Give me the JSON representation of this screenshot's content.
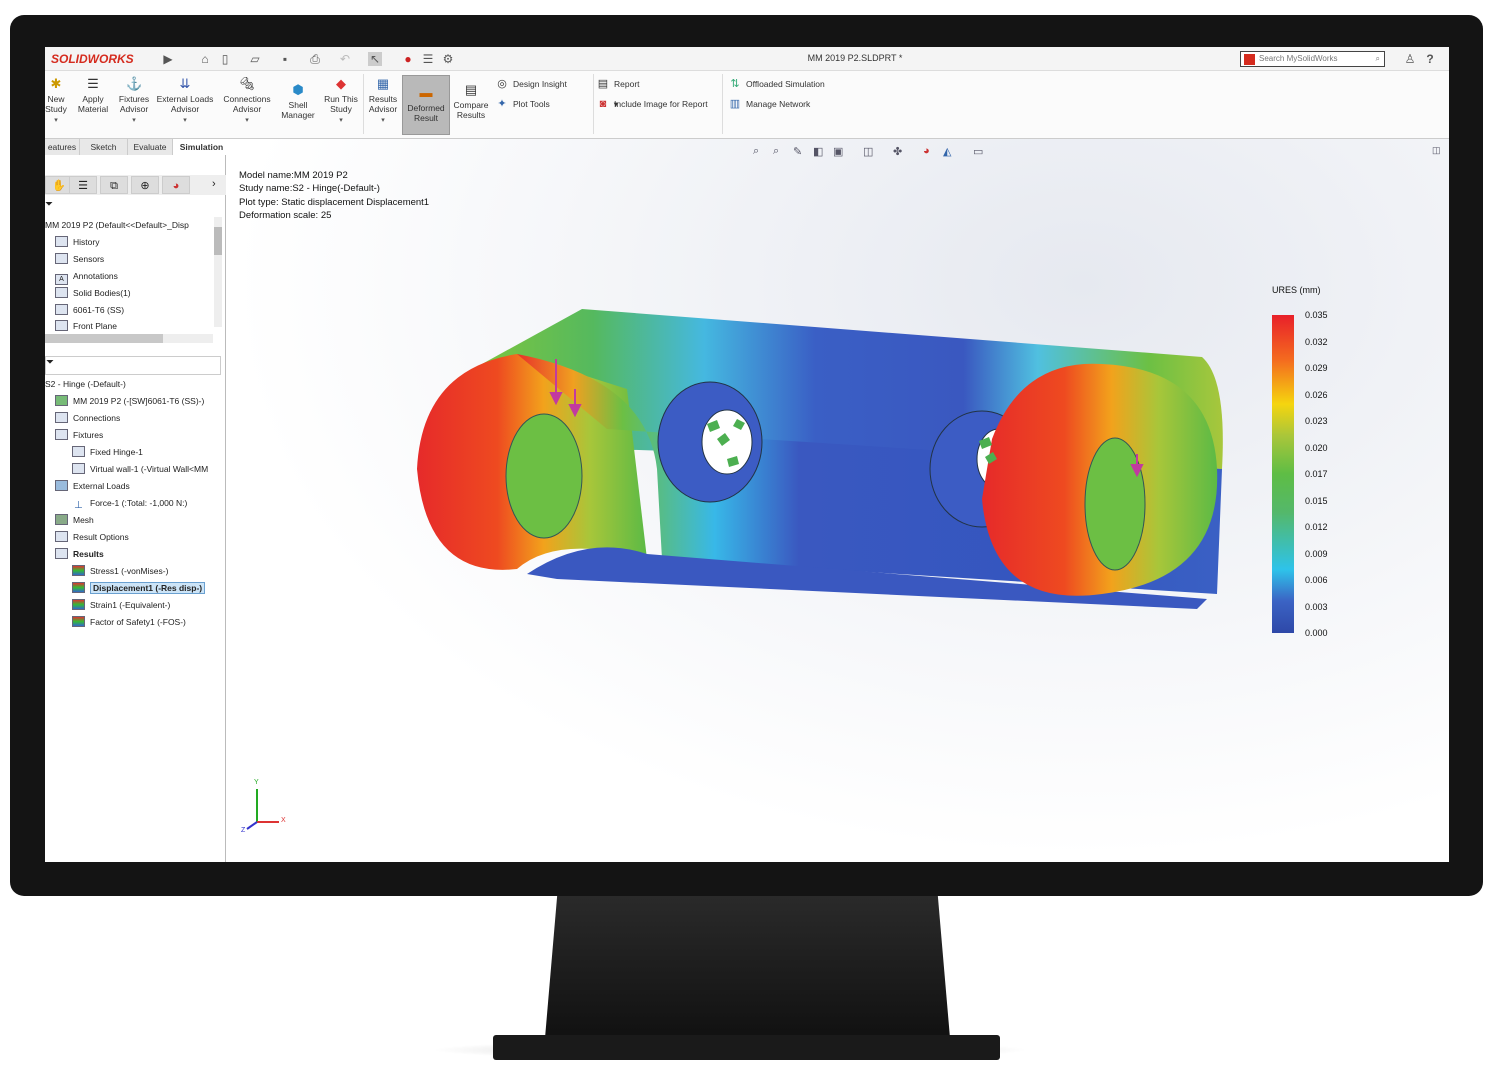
{
  "app": {
    "brand": "SOLIDWORKS",
    "document_title": "MM 2019 P2.SLDPRT *",
    "search_placeholder": "Search MySolidWorks",
    "help": "?"
  },
  "ribbon": {
    "buttons": [
      {
        "label": "New Study",
        "icon": "new-study-icon"
      },
      {
        "label": "Apply Material",
        "icon": "apply-material-icon"
      },
      {
        "label": "Fixtures Advisor",
        "icon": "fixtures-icon"
      },
      {
        "label": "External Loads Advisor",
        "icon": "external-loads-icon"
      },
      {
        "label": "Connections Advisor",
        "icon": "connections-icon"
      },
      {
        "label": "Shell Manager",
        "icon": "shell-icon"
      },
      {
        "label": "Run This Study",
        "icon": "run-study-icon"
      },
      {
        "label": "Results Advisor",
        "icon": "results-advisor-icon"
      },
      {
        "label": "Deformed Result",
        "icon": "deformed-result-icon",
        "active": true
      },
      {
        "label": "Compare Results",
        "icon": "compare-results-icon"
      }
    ],
    "small": [
      "Design Insight",
      "Plot Tools",
      "Report",
      "Include Image for Report",
      "Offloaded Simulation",
      "Manage Network"
    ]
  },
  "tabs": [
    "eatures",
    "Sketch",
    "Evaluate",
    "Simulation"
  ],
  "active_tab": "Simulation",
  "feature_tree": [
    "MM 2019 P2  (Default<<Default>_Disp",
    "History",
    "Sensors",
    "Annotations",
    "Solid Bodies(1)",
    "6061-T6 (SS)",
    "Front Plane"
  ],
  "study_tree": [
    {
      "label": "S2 - Hinge (-Default-)",
      "level": 0
    },
    {
      "label": "MM 2019 P2 (-[SW]6061-T6 (SS)-)",
      "level": 1
    },
    {
      "label": "Connections",
      "level": 1
    },
    {
      "label": "Fixtures",
      "level": 1
    },
    {
      "label": "Fixed Hinge-1",
      "level": 2
    },
    {
      "label": "Virtual wall-1 (-Virtual Wall<MM",
      "level": 2
    },
    {
      "label": "External Loads",
      "level": 1
    },
    {
      "label": "Force-1 (:Total: -1,000 N:)",
      "level": 2
    },
    {
      "label": "Mesh",
      "level": 1
    },
    {
      "label": "Result Options",
      "level": 1
    },
    {
      "label": "Results",
      "level": 1,
      "bold": true
    },
    {
      "label": "Stress1 (-vonMises-)",
      "level": 2
    },
    {
      "label": "Displacement1 (-Res disp-)",
      "level": 2,
      "selected": true
    },
    {
      "label": "Strain1 (-Equivalent-)",
      "level": 2
    },
    {
      "label": "Factor of Safety1 (-FOS-)",
      "level": 2
    }
  ],
  "viewport": {
    "info": [
      "Model name:MM 2019 P2",
      "Study name:S2 - Hinge(-Default-)",
      "Plot type: Static displacement Displacement1",
      "Deformation scale: 25"
    ],
    "legend_title": "URES (mm)",
    "legend_ticks": [
      "0.035",
      "0.032",
      "0.029",
      "0.026",
      "0.023",
      "0.020",
      "0.017",
      "0.015",
      "0.012",
      "0.009",
      "0.006",
      "0.003",
      "0.000"
    ],
    "triad": {
      "x": "X",
      "y": "Y",
      "z": "Z"
    }
  },
  "colors": {
    "brand": "#d52b1e",
    "selection": "#cce4f7",
    "max": "#e8202a",
    "min": "#2e48a8"
  }
}
